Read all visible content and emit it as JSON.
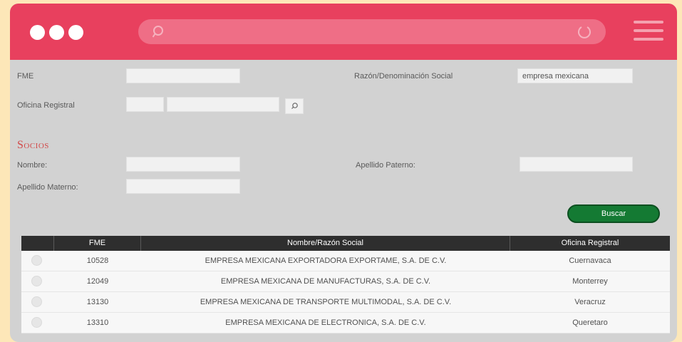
{
  "form": {
    "fme_label": "FME",
    "razon_label": "Razón/Denominación Social",
    "razon_value": "empresa mexicana",
    "oficina_label": "Oficina Registral",
    "section_title": "Socios",
    "nombre_label": "Nombre:",
    "apellido_paterno_label": "Apellido Paterno:",
    "apellido_materno_label": "Apellido Materno:",
    "buscar_label": "Buscar"
  },
  "table": {
    "headers": [
      "FME",
      "Nombre/Razón Social",
      "Oficina Registral"
    ],
    "rows": [
      {
        "fme": "10528",
        "nombre": "EMPRESA MEXICANA EXPORTADORA EXPORTAME, S.A. DE C.V.",
        "oficina": "Cuernavaca"
      },
      {
        "fme": "12049",
        "nombre": "EMPRESA MEXICANA DE MANUFACTURAS, S.A. DE C.V.",
        "oficina": "Monterrey"
      },
      {
        "fme": "13130",
        "nombre": "EMPRESA MEXICANA DE TRANSPORTE MULTIMODAL, S.A. DE C.V.",
        "oficina": "Veracruz"
      },
      {
        "fme": "13310",
        "nombre": "EMPRESA MEXICANA DE ELECTRONICA, S.A. DE C.V.",
        "oficina": "Queretaro"
      }
    ]
  },
  "colors": {
    "titlebar": "#e8405e",
    "button": "#147a33",
    "section": "#d24a4a"
  }
}
